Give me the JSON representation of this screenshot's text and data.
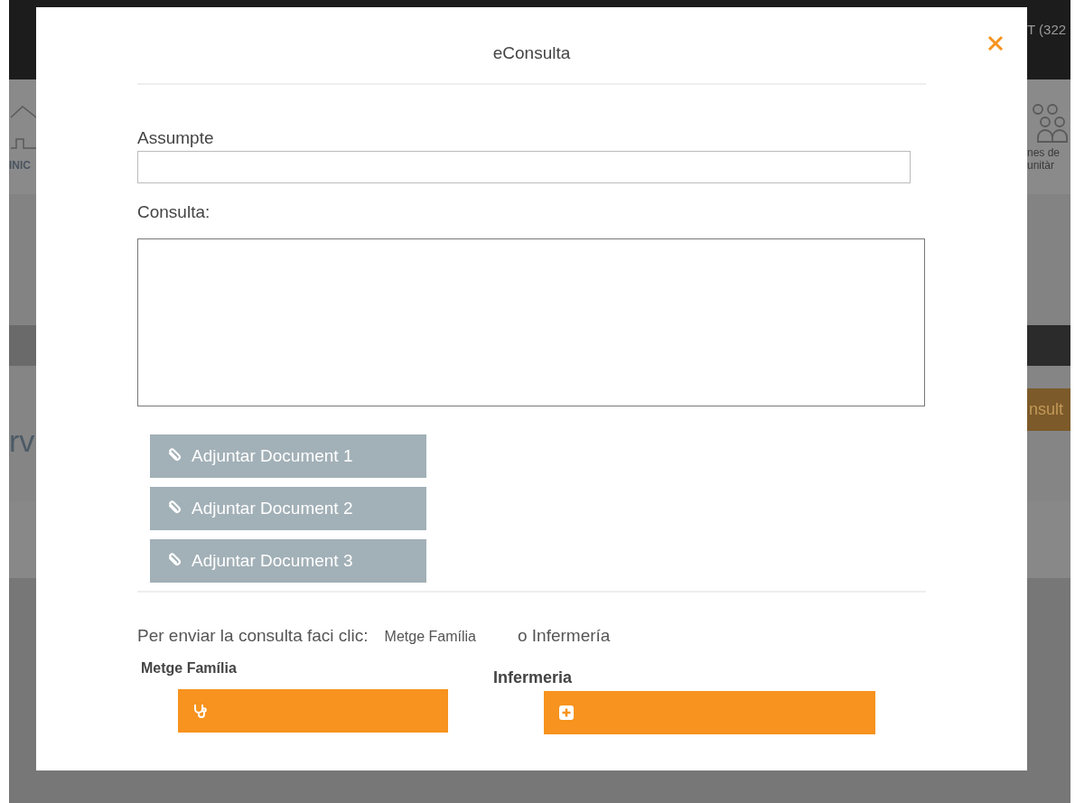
{
  "background": {
    "top_right_text": "T (322",
    "left_nav_label": "INIC",
    "right_nav_label": [
      "nes de",
      "unitàr"
    ],
    "left_heading": "rv",
    "right_button": "nsult"
  },
  "modal": {
    "title": "eConsulta",
    "subject": {
      "label": "Assumpte"
    },
    "query": {
      "label": "Consulta:"
    },
    "attachments": [
      {
        "label": "Adjuntar Document 1"
      },
      {
        "label": "Adjuntar Document 2"
      },
      {
        "label": "Adjuntar Document 3"
      }
    ],
    "send": {
      "prompt": "Per enviar la consulta faci clic:",
      "option": "Metge Família",
      "alternative": "o Infermería"
    },
    "recipients": [
      {
        "label": "Metge Família",
        "kind": "doctor"
      },
      {
        "label": "Infermeria",
        "kind": "nurse"
      }
    ]
  }
}
